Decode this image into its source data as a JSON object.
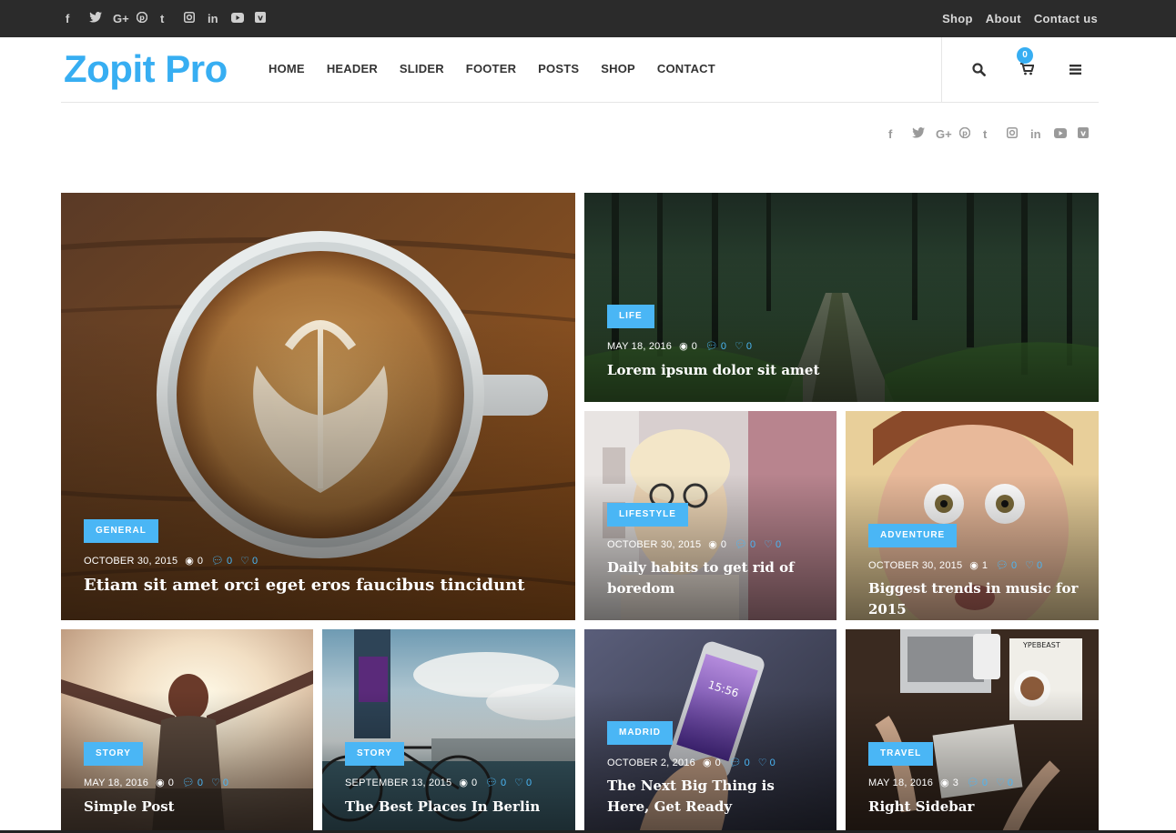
{
  "topbar": {
    "socials": [
      "facebook-icon",
      "twitter-icon",
      "google-plus-icon",
      "pinterest-icon",
      "tumblr-icon",
      "instagram-icon",
      "linkedin-icon",
      "youtube-icon",
      "vimeo-icon"
    ],
    "links": [
      "Shop",
      "About",
      "Contact us"
    ]
  },
  "header": {
    "logo": "Zopit Pro",
    "nav": [
      "HOME",
      "HEADER",
      "SLIDER",
      "FOOTER",
      "POSTS",
      "SHOP",
      "CONTACT"
    ],
    "cart_count": "0",
    "icons": [
      "search-icon",
      "cart-icon",
      "menu-icon"
    ]
  },
  "colors": {
    "accent": "#37aef2",
    "category": "#4ab6f5",
    "topbar": "#2b2b2b"
  },
  "posts": [
    {
      "category": "GENERAL",
      "date": "OCTOBER 30, 2015",
      "views": "0",
      "comments": "0",
      "likes": "0",
      "title": "Etiam sit amet orci eget eros faucibus tincidunt"
    },
    {
      "category": "LIFE",
      "date": "MAY 18, 2016",
      "views": "0",
      "comments": "0",
      "likes": "0",
      "title": "Lorem ipsum dolor sit amet"
    },
    {
      "category": "LIFESTYLE",
      "date": "OCTOBER 30, 2015",
      "views": "0",
      "comments": "0",
      "likes": "0",
      "title": "Daily habits to get rid of boredom"
    },
    {
      "category": "ADVENTURE",
      "date": "OCTOBER 30, 2015",
      "views": "1",
      "comments": "0",
      "likes": "0",
      "title": "Biggest trends in music for 2015"
    },
    {
      "category": "STORY",
      "date": "MAY 18, 2016",
      "views": "0",
      "comments": "0",
      "likes": "0",
      "title": "Simple Post"
    },
    {
      "category": "STORY",
      "date": "SEPTEMBER 13, 2015",
      "views": "0",
      "comments": "0",
      "likes": "0",
      "title": "The Best Places In Berlin"
    },
    {
      "category": "MADRID",
      "date": "OCTOBER 2, 2016",
      "views": "0",
      "comments": "0",
      "likes": "0",
      "title": "The Next Big Thing is Here, Get Ready"
    },
    {
      "category": "TRAVEL",
      "date": "MAY 18, 2016",
      "views": "3",
      "comments": "0",
      "likes": "0",
      "title": "Right Sidebar"
    }
  ]
}
